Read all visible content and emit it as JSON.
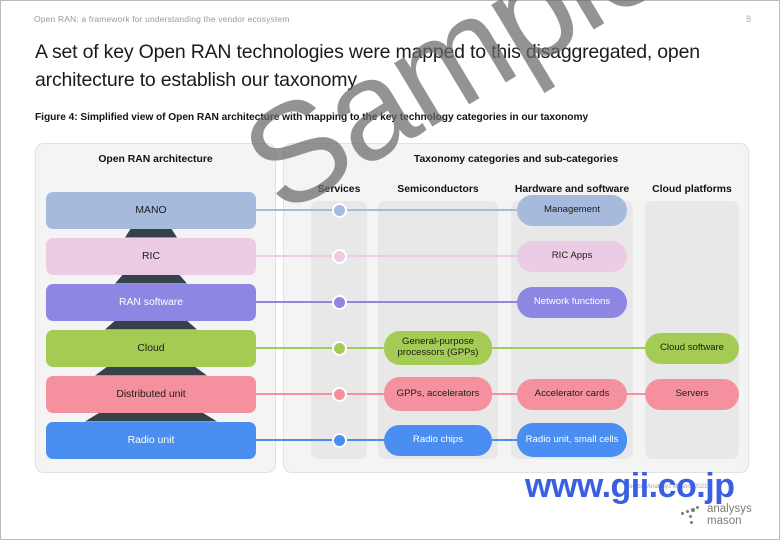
{
  "header": {
    "title": "Open RAN: a framework for understanding the vendor ecosystem",
    "page_number": "8"
  },
  "slide": {
    "title": "A set of key Open RAN technologies were mapped to this disaggregated, open architecture to establish our taxonomy",
    "figure_caption": "Figure 4: Simplified view of Open RAN architecture with mapping to the key technology categories in our taxonomy"
  },
  "watermark": {
    "text": "Sample",
    "url": "www.gii.co.jp",
    "source": "Source: Analysys Mason, 2021"
  },
  "logo": {
    "line1": "analysys",
    "line2": "mason"
  },
  "diagram": {
    "left_panel_heading": "Open RAN architecture",
    "right_panel_heading": "Taxonomy categories and sub-categories",
    "columns": [
      {
        "label": "Services"
      },
      {
        "label": "Semiconductors"
      },
      {
        "label": "Hardware and software"
      },
      {
        "label": "Cloud platforms"
      }
    ],
    "architecture_layers": [
      {
        "label": "MANO",
        "color": "#a6bade",
        "text_color": "dark"
      },
      {
        "label": "RIC",
        "color": "#ebcce4",
        "text_color": "dark"
      },
      {
        "label": "RAN software",
        "color": "#8e86e3",
        "text_color": "light"
      },
      {
        "label": "Cloud",
        "color": "#a4cc54",
        "text_color": "dark"
      },
      {
        "label": "Distributed unit",
        "color": "#f5919f",
        "text_color": "dark"
      },
      {
        "label": "Radio unit",
        "color": "#4b8ef2",
        "text_color": "light"
      }
    ],
    "rows": [
      {
        "row_color": "#a6bade",
        "services_dot": true,
        "semiconductors": null,
        "hardware_software": {
          "label": "Management",
          "text_color": "dark"
        },
        "cloud_platforms": null
      },
      {
        "row_color": "#ebcce4",
        "services_dot": true,
        "semiconductors": null,
        "hardware_software": {
          "label": "RIC Apps",
          "text_color": "dark"
        },
        "cloud_platforms": null
      },
      {
        "row_color": "#8e86e3",
        "services_dot": true,
        "semiconductors": null,
        "hardware_software": {
          "label": "Network functions",
          "text_color": "light"
        },
        "cloud_platforms": null
      },
      {
        "row_color": "#a4cc54",
        "services_dot": true,
        "semiconductors": {
          "label": "General-purpose processors (GPPs)",
          "text_color": "dark"
        },
        "hardware_software": null,
        "cloud_platforms": {
          "label": "Cloud software",
          "text_color": "dark"
        }
      },
      {
        "row_color": "#f5919f",
        "services_dot": true,
        "semiconductors": {
          "label": "GPPs, accelerators",
          "text_color": "dark"
        },
        "hardware_software": {
          "label": "Accelerator cards",
          "text_color": "dark"
        },
        "cloud_platforms": {
          "label": "Servers",
          "text_color": "dark"
        }
      },
      {
        "row_color": "#4b8ef2",
        "services_dot": true,
        "semiconductors": {
          "label": "Radio chips",
          "text_color": "light"
        },
        "hardware_software": {
          "label": "Radio unit, small cells",
          "text_color": "light"
        },
        "cloud_platforms": null
      }
    ]
  }
}
